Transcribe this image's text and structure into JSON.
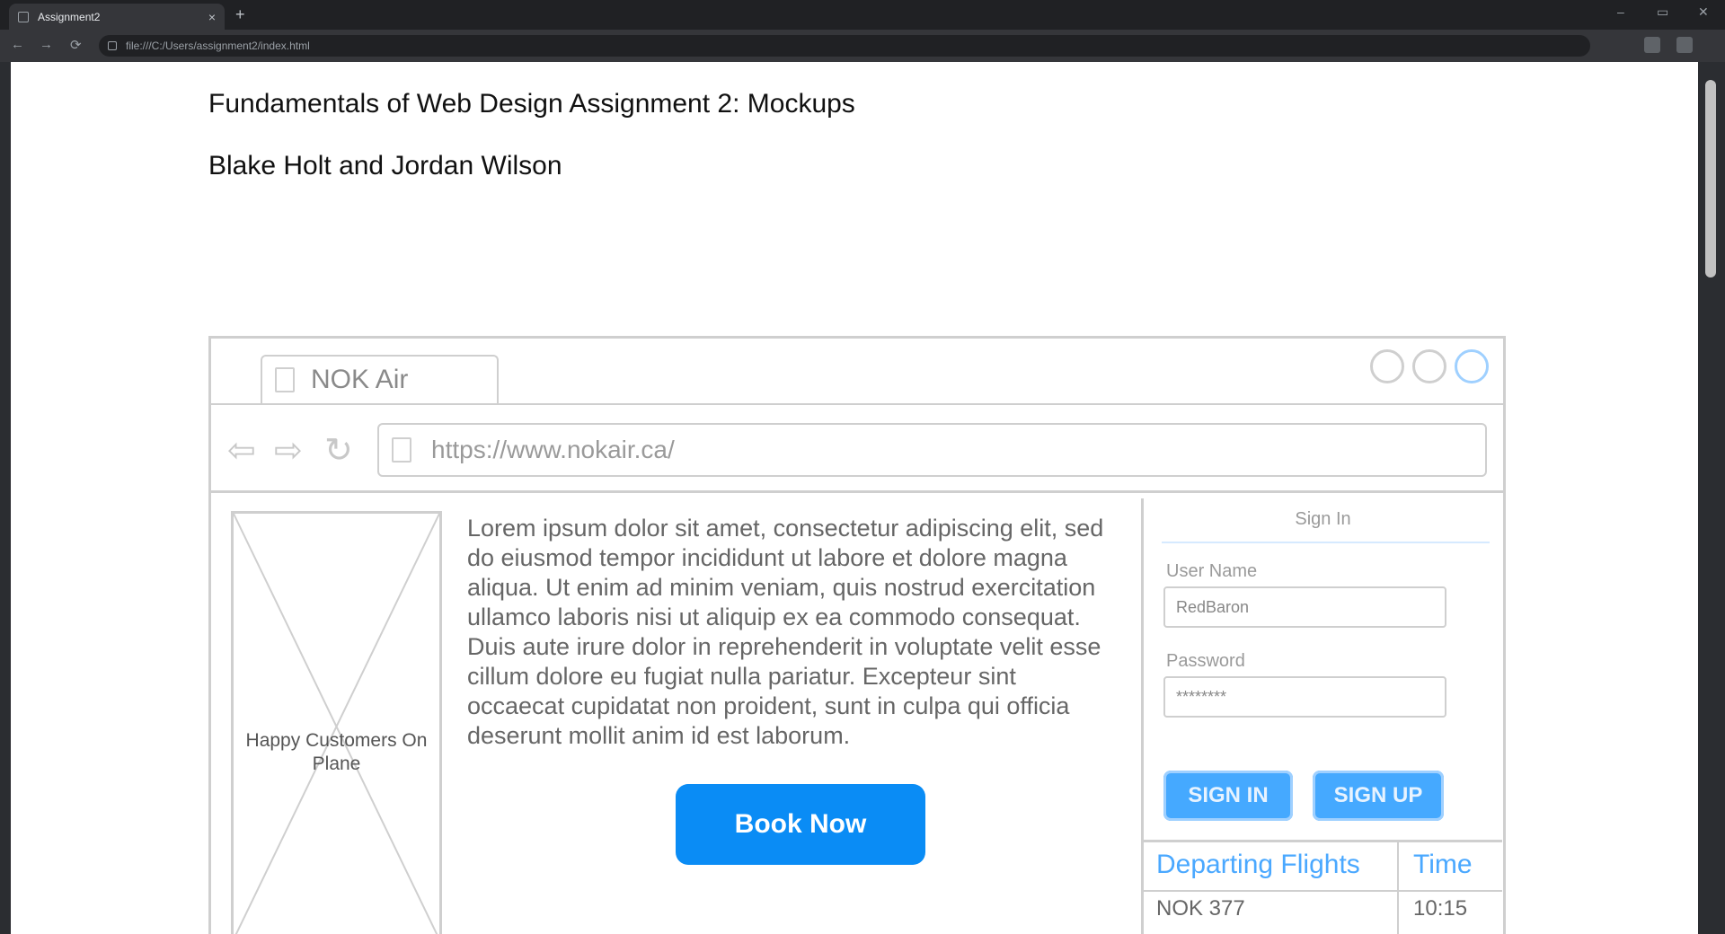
{
  "browser": {
    "tab_title": "Assignment2",
    "tab_close": "×",
    "new_tab": "+",
    "address": "file:///C:/Users/assignment2/index.html",
    "nav_back": "←",
    "nav_forward": "→",
    "reload": "⟳"
  },
  "document": {
    "title": "Fundamentals of Web Design Assignment 2: Mockups",
    "authors": "Blake Holt and Jordan Wilson"
  },
  "mockup": {
    "tab_title": "NOK Air",
    "url": "https://www.nokair.ca/",
    "nav_back": "⇦",
    "nav_forward": "⇨",
    "nav_reload": "↻",
    "image_label": "Happy Customers On Plane",
    "lorem": "Lorem ipsum dolor sit amet, consectetur adipiscing elit, sed do eiusmod tempor incididunt ut labore et dolore magna aliqua. Ut enim ad minim veniam, quis nostrud exercitation ullamco laboris nisi ut aliquip ex ea commodo consequat. Duis aute irure dolor in reprehenderit in voluptate velit esse cillum dolore eu fugiat nulla pariatur. Excepteur sint occaecat cupidatat non proident, sunt in culpa qui officia deserunt mollit anim id est laborum.",
    "book_now": "Book Now",
    "signin": {
      "title": "Sign In",
      "username_label": "User Name",
      "username_value": "RedBaron",
      "password_label": "Password",
      "password_value": "********",
      "signin_button": "SIGN IN",
      "signup_button": "SIGN UP"
    },
    "flights": {
      "col_departing": "Departing Flights",
      "col_time": "Time",
      "rows": [
        {
          "flight": "NOK 377",
          "time": "10:15"
        }
      ]
    }
  },
  "colors": {
    "accent": "#0a8cf5",
    "link_blue": "#4aa8ff"
  }
}
